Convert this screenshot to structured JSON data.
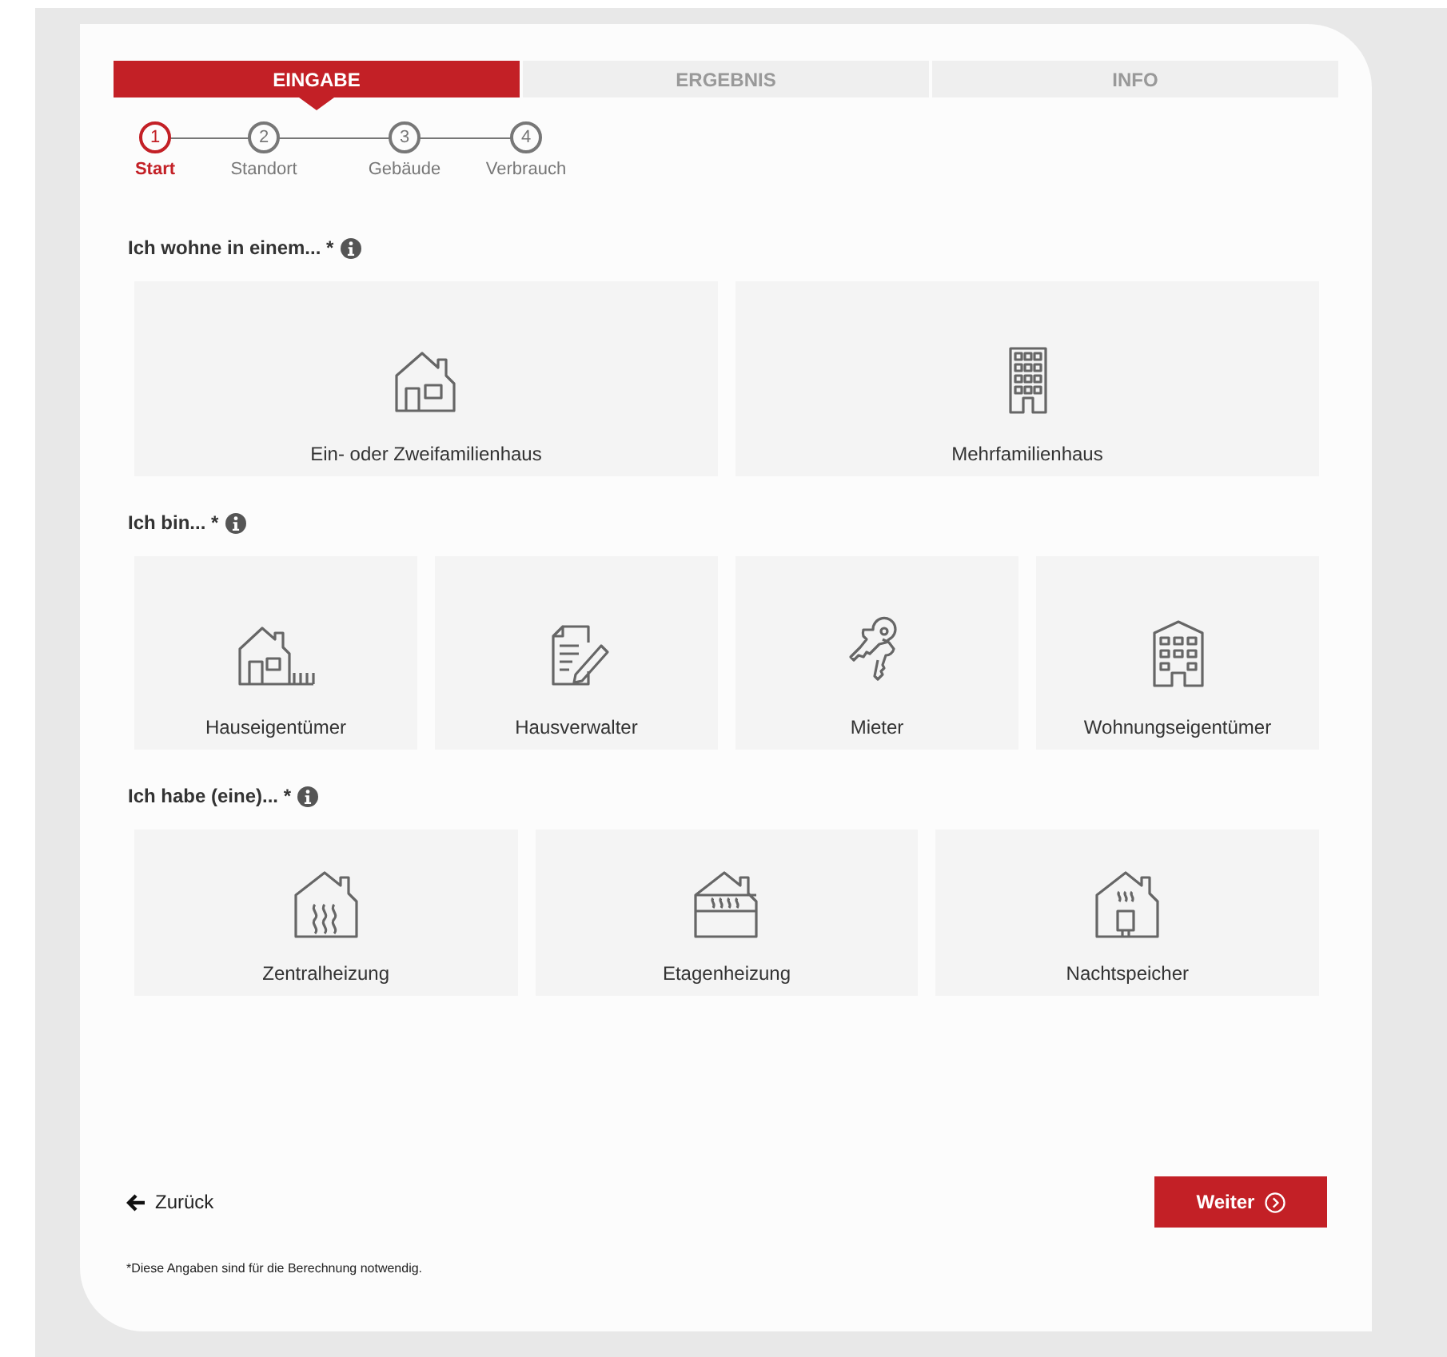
{
  "tabs": [
    {
      "label": "EINGABE",
      "selected": true
    },
    {
      "label": "ERGEBNIS",
      "selected": false
    },
    {
      "label": "INFO",
      "selected": false
    }
  ],
  "steps": [
    {
      "number": "1",
      "label": "Start",
      "selected": true
    },
    {
      "number": "2",
      "label": "Standort",
      "selected": false
    },
    {
      "number": "3",
      "label": "Gebäude",
      "selected": false
    },
    {
      "number": "4",
      "label": "Verbrauch",
      "selected": false
    }
  ],
  "groups": [
    {
      "title": "Ich wohne in einem... *",
      "options": [
        {
          "label": "Ein- oder Zweifamilienhaus",
          "kind": "house"
        },
        {
          "label": "Mehrfamilienhaus",
          "kind": "tower"
        }
      ]
    },
    {
      "title": "Ich bin... *",
      "options": [
        {
          "label": "Hauseigentümer",
          "kind": "house-fence"
        },
        {
          "label": "Hausverwalter",
          "kind": "document"
        },
        {
          "label": "Mieter",
          "kind": "keys"
        },
        {
          "label": "Wohnungseigentümer",
          "kind": "apartment"
        }
      ]
    },
    {
      "title": "Ich habe (eine)... *",
      "options": [
        {
          "label": "Zentralheizung",
          "kind": "central-heating"
        },
        {
          "label": "Etagenheizung",
          "kind": "floor-heating"
        },
        {
          "label": "Nachtspeicher",
          "kind": "storage-heater"
        }
      ]
    }
  ],
  "back": {
    "label": "Zurück"
  },
  "next": {
    "label": "Weiter"
  },
  "footnote": "*Diese Angaben sind für die Berechnung notwendig."
}
